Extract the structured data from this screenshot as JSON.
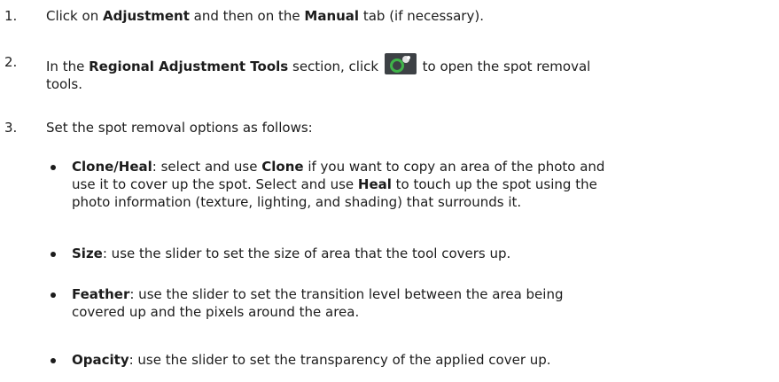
{
  "steps": [
    {
      "number": "1.",
      "p1": "Click on ",
      "b1": "Adjustment",
      "p2": " and then on the ",
      "b2": "Manual",
      "p3": " tab (if necessary)."
    },
    {
      "number": "2.",
      "p1": "In the ",
      "b1": "Regional Adjustment Tools",
      "p2": " section, click",
      "icon": "spot-removal-tool-icon",
      "p3": "to open the spot removal",
      "p4": "tools."
    },
    {
      "number": "3.",
      "p1": "Set the spot removal options as follows:"
    }
  ],
  "options": [
    {
      "lines": [
        {
          "b1": "Clone/Heal",
          "p1": ": select and use ",
          "b2": "Clone",
          "p2": " if you want to copy an area of the photo and"
        },
        {
          "p1": "use it to cover up the spot. Select and use ",
          "b1": "Heal",
          "p2": " to touch up the spot using the"
        },
        {
          "p1": "photo information (texture, lighting, and shading) that surrounds it."
        }
      ]
    },
    {
      "lines": [
        {
          "b1": "Size",
          "p1": ": use the slider to set the size of area that the tool covers up."
        }
      ]
    },
    {
      "lines": [
        {
          "b1": "Feather",
          "p1": ": use the slider to set the transition level between the area being"
        },
        {
          "p1": "covered up and the pixels around the area."
        }
      ]
    },
    {
      "lines": [
        {
          "b1": "Opacity",
          "p1": ": use the slider to set the transparency of the applied cover up."
        }
      ]
    }
  ],
  "colors": {
    "text": "#1c1c1c",
    "icon_bg": "#3d4145",
    "icon_circle": "#3fb449",
    "icon_dot": "#ffffff"
  }
}
